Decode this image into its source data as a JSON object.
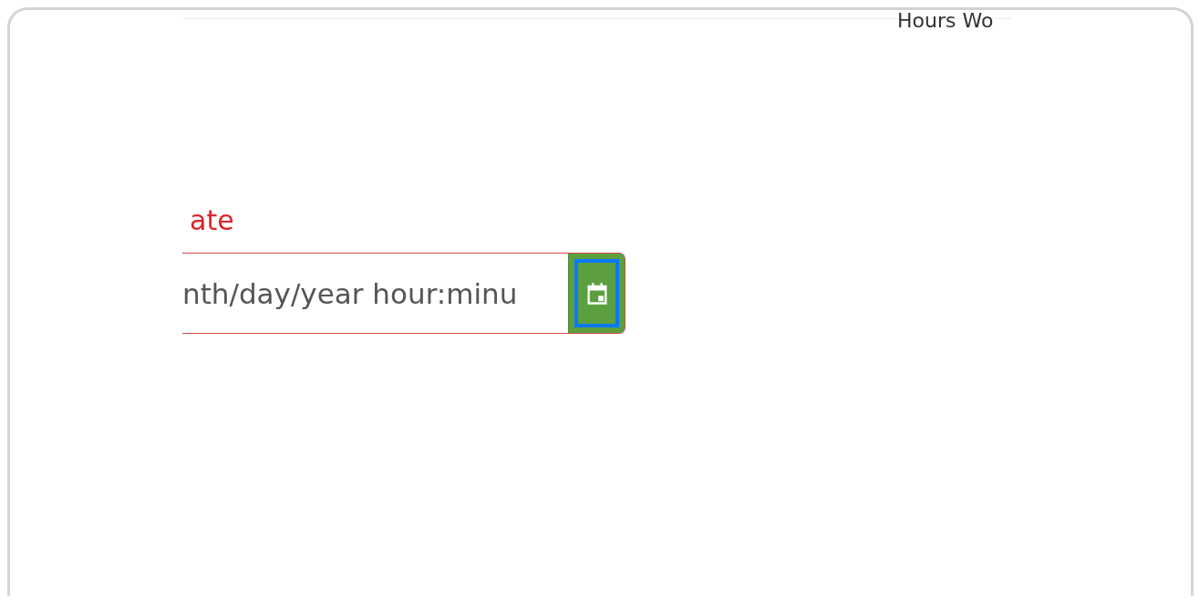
{
  "header": {
    "column_label": "Hours Wo"
  },
  "date_field": {
    "label": "ate",
    "placeholder": "nth/day/year hour:minu",
    "invalid": true,
    "button_focused": true
  }
}
